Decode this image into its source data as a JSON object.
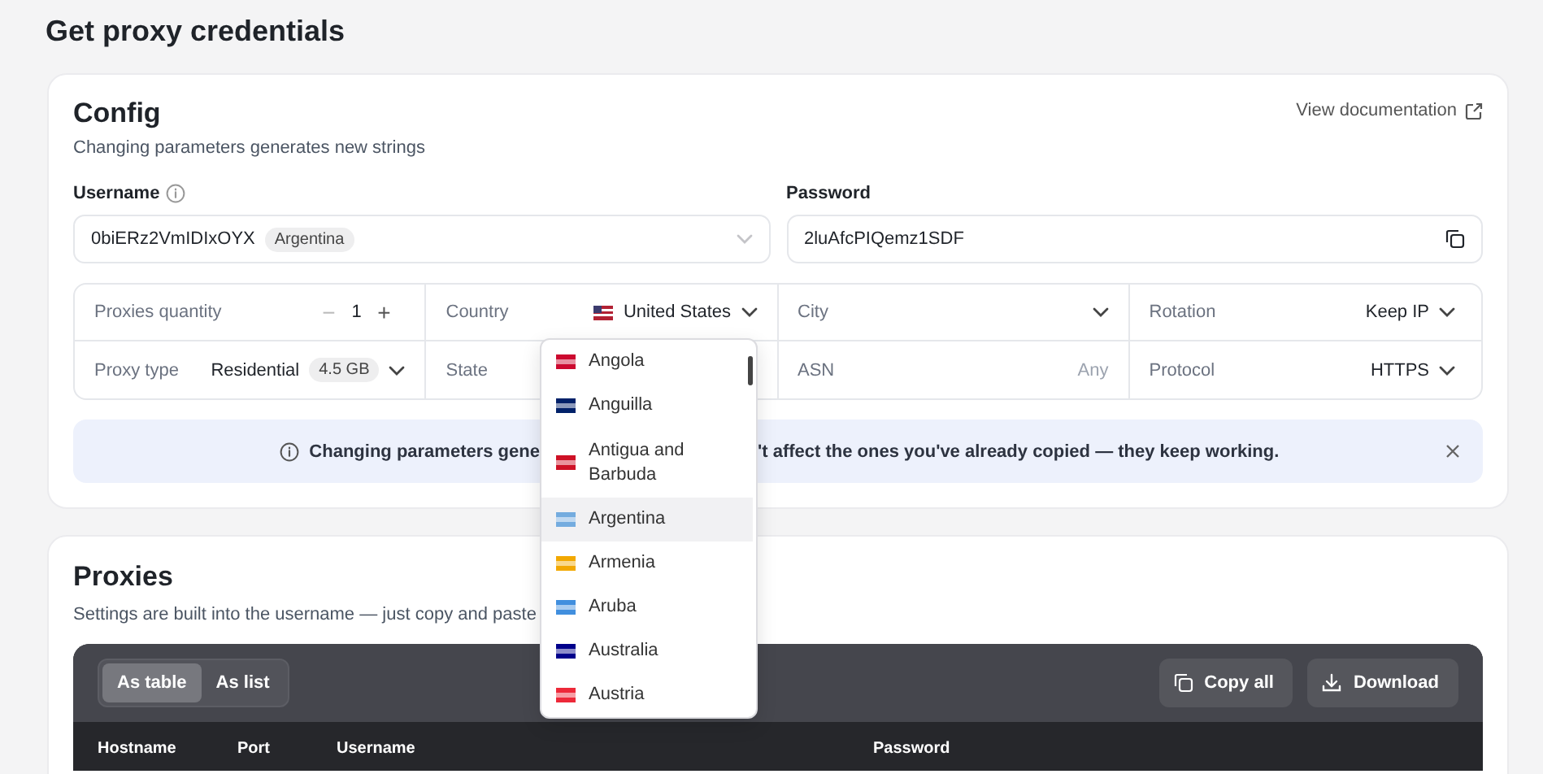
{
  "page_title": "Get proxy credentials",
  "config": {
    "title": "Config",
    "subtitle": "Changing parameters generates new strings",
    "doc_link": "View documentation",
    "username": {
      "label": "Username",
      "value": "0biERz2VmIDIxOYX",
      "badge": "Argentina"
    },
    "password": {
      "label": "Password",
      "value": "2luAfcPIQemz1SDF"
    },
    "params": [
      {
        "kind": "stepper",
        "label": "Proxies quantity",
        "value": "1",
        "decrement": "−",
        "increment": "+"
      },
      {
        "kind": "select",
        "label": "Country",
        "value": "United States",
        "color": "#b22234"
      },
      {
        "kind": "select",
        "label": "City"
      },
      {
        "kind": "select",
        "label": "Rotation",
        "value": "Keep IP"
      },
      {
        "kind": "select",
        "label": "Proxy type",
        "value": "Residential",
        "badge": "4.5 GB"
      },
      {
        "kind": "plain",
        "label": "State"
      },
      {
        "kind": "input",
        "label": "ASN",
        "placeholder": "Any"
      },
      {
        "kind": "select",
        "label": "Protocol",
        "value": "HTTPS"
      }
    ],
    "notice": {
      "text_before": "Changing parameters gene",
      "text_after": "'t affect the ones you've already copied — they keep working."
    },
    "country_dropdown": [
      {
        "name": "Angola",
        "color": "#cc092f",
        "selected": false
      },
      {
        "name": "Anguilla",
        "color": "#012169",
        "selected": false
      },
      {
        "name": "Antigua and Barbuda",
        "color": "#ce1126",
        "selected": false
      },
      {
        "name": "Argentina",
        "color": "#74acdf",
        "selected": true
      },
      {
        "name": "Armenia",
        "color": "#f2a800",
        "selected": false
      },
      {
        "name": "Aruba",
        "color": "#418fde",
        "selected": false
      },
      {
        "name": "Australia",
        "color": "#00008b",
        "selected": false
      },
      {
        "name": "Austria",
        "color": "#ed2939",
        "selected": false
      }
    ]
  },
  "proxies": {
    "title": "Proxies",
    "subtitle": "Settings are built into the username — just copy and paste",
    "view_toggle": [
      {
        "label": "As table",
        "selected": true
      },
      {
        "label": "As list",
        "selected": false
      }
    ],
    "actions": [
      {
        "kind": "copy",
        "label": "Copy all"
      },
      {
        "kind": "download",
        "label": "Download"
      }
    ],
    "table": {
      "columns": [
        "Hostname",
        "Port",
        "Username",
        "Password"
      ]
    }
  }
}
